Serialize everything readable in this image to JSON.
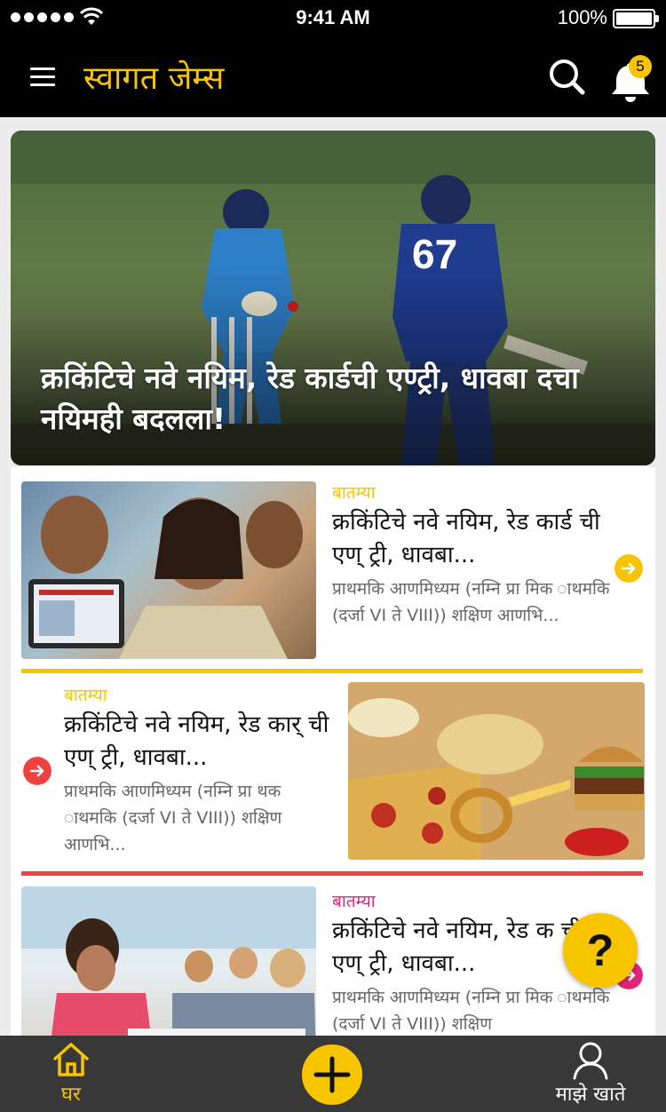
{
  "status_bar": {
    "time": "9:41 AM",
    "battery": "100%"
  },
  "header": {
    "title": "स्वागत जेम्स",
    "notification_count": "5"
  },
  "hero": {
    "title": "क्रकिंटिचे नवे नयिम, रेड कार्डची एण्ट्री, धावबा दचा नयिमही बदलला!"
  },
  "articles": [
    {
      "category": "बातम्या",
      "headline": "क्रकिंटिचे नवे नयिम, रेड कार्ड ची एण् ट्री, धावबा...",
      "desc": "प्राथमकि आणमिध्यम (नम्नि प्रा मिक ाथमकि (दर्जा VI ते VIII)) शक्षिण आणभि...",
      "accent": "#f6c500"
    },
    {
      "category": "बातम्या",
      "headline": "क्रकिंटिचे नवे नयिम, रेड कार् ची एण् ट्री, धावबा...",
      "desc": "प्राथमकि आणमिध्यम (नम्नि प्रा थक ाथमकि (दर्जा VI ते VIII)) शक्षिण आणभि...",
      "accent": "#f04040"
    },
    {
      "category": "बातम्या",
      "headline": "क्रकिंटिचे नवे नयिम, रेड क ची एण् ट्री, धावबा...",
      "desc": "प्राथमकि आणमिध्यम (नम्नि प्रा मिक ाथमकि (दर्जा VI ते VIII)) शक्षिण",
      "accent": "#e0267a"
    }
  ],
  "help": {
    "label": "?"
  },
  "nav": {
    "home": "घर",
    "account": "माझे खाते"
  },
  "icons": [
    "signal-icon",
    "wifi-icon",
    "battery-icon",
    "menu-icon",
    "search-icon",
    "bell-icon",
    "arrow-right-icon",
    "help-icon",
    "home-icon",
    "plus-icon",
    "user-icon"
  ]
}
